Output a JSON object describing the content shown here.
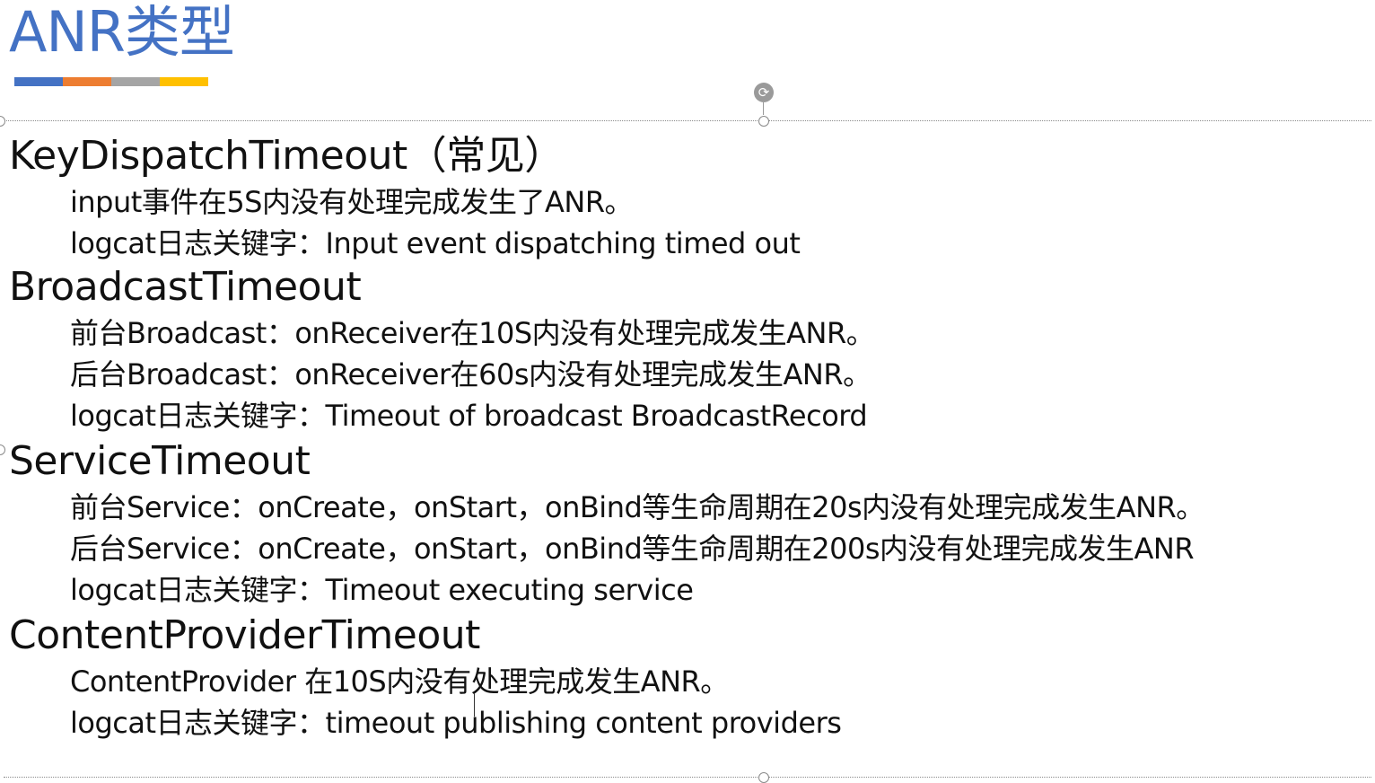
{
  "slide": {
    "title": "ANR类型",
    "title_color": "#4472c4",
    "underline_colors": [
      "#4472c4",
      "#ed7d31",
      "#a5a5a5",
      "#ffc000"
    ],
    "rotate_icon": "rotate-icon"
  },
  "sections": [
    {
      "heading": "KeyDispatchTimeout（常见）",
      "lines": [
        "input事件在5S内没有处理完成发生了ANR。",
        "logcat日志关键字：Input event dispatching timed out"
      ]
    },
    {
      "heading": "BroadcastTimeout",
      "lines": [
        "前台Broadcast：onReceiver在10S内没有处理完成发生ANR。",
        "后台Broadcast：onReceiver在60s内没有处理完成发生ANR。",
        "logcat日志关键字：Timeout of broadcast BroadcastRecord"
      ]
    },
    {
      "heading": "ServiceTimeout",
      "lines": [
        "前台Service：onCreate，onStart，onBind等生命周期在20s内没有处理完成发生ANR。",
        "后台Service：onCreate，onStart，onBind等生命周期在200s内没有处理完成发生ANR",
        "logcat日志关键字：Timeout executing service"
      ]
    },
    {
      "heading": "ContentProviderTimeout",
      "lines": [
        "ContentProvider 在10S内没有处理完成发生ANR。",
        "logcat日志关键字：timeout publishing content providers"
      ]
    }
  ]
}
